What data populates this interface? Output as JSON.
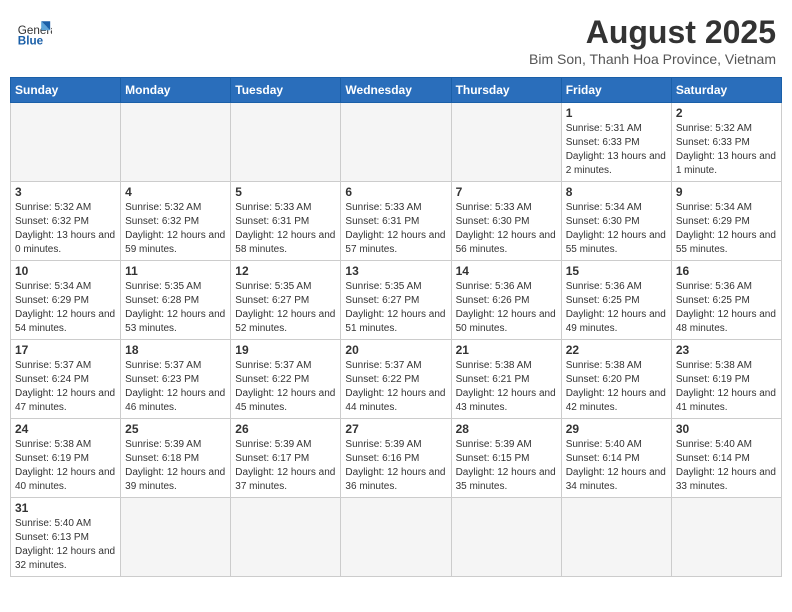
{
  "header": {
    "logo_general": "General",
    "logo_blue": "Blue",
    "month_year": "August 2025",
    "location": "Bim Son, Thanh Hoa Province, Vietnam"
  },
  "weekdays": [
    "Sunday",
    "Monday",
    "Tuesday",
    "Wednesday",
    "Thursday",
    "Friday",
    "Saturday"
  ],
  "weeks": [
    [
      {
        "day": "",
        "info": ""
      },
      {
        "day": "",
        "info": ""
      },
      {
        "day": "",
        "info": ""
      },
      {
        "day": "",
        "info": ""
      },
      {
        "day": "",
        "info": ""
      },
      {
        "day": "1",
        "info": "Sunrise: 5:31 AM\nSunset: 6:33 PM\nDaylight: 13 hours\nand 2 minutes."
      },
      {
        "day": "2",
        "info": "Sunrise: 5:32 AM\nSunset: 6:33 PM\nDaylight: 13 hours\nand 1 minute."
      }
    ],
    [
      {
        "day": "3",
        "info": "Sunrise: 5:32 AM\nSunset: 6:32 PM\nDaylight: 13 hours\nand 0 minutes."
      },
      {
        "day": "4",
        "info": "Sunrise: 5:32 AM\nSunset: 6:32 PM\nDaylight: 12 hours\nand 59 minutes."
      },
      {
        "day": "5",
        "info": "Sunrise: 5:33 AM\nSunset: 6:31 PM\nDaylight: 12 hours\nand 58 minutes."
      },
      {
        "day": "6",
        "info": "Sunrise: 5:33 AM\nSunset: 6:31 PM\nDaylight: 12 hours\nand 57 minutes."
      },
      {
        "day": "7",
        "info": "Sunrise: 5:33 AM\nSunset: 6:30 PM\nDaylight: 12 hours\nand 56 minutes."
      },
      {
        "day": "8",
        "info": "Sunrise: 5:34 AM\nSunset: 6:30 PM\nDaylight: 12 hours\nand 55 minutes."
      },
      {
        "day": "9",
        "info": "Sunrise: 5:34 AM\nSunset: 6:29 PM\nDaylight: 12 hours\nand 55 minutes."
      }
    ],
    [
      {
        "day": "10",
        "info": "Sunrise: 5:34 AM\nSunset: 6:29 PM\nDaylight: 12 hours\nand 54 minutes."
      },
      {
        "day": "11",
        "info": "Sunrise: 5:35 AM\nSunset: 6:28 PM\nDaylight: 12 hours\nand 53 minutes."
      },
      {
        "day": "12",
        "info": "Sunrise: 5:35 AM\nSunset: 6:27 PM\nDaylight: 12 hours\nand 52 minutes."
      },
      {
        "day": "13",
        "info": "Sunrise: 5:35 AM\nSunset: 6:27 PM\nDaylight: 12 hours\nand 51 minutes."
      },
      {
        "day": "14",
        "info": "Sunrise: 5:36 AM\nSunset: 6:26 PM\nDaylight: 12 hours\nand 50 minutes."
      },
      {
        "day": "15",
        "info": "Sunrise: 5:36 AM\nSunset: 6:25 PM\nDaylight: 12 hours\nand 49 minutes."
      },
      {
        "day": "16",
        "info": "Sunrise: 5:36 AM\nSunset: 6:25 PM\nDaylight: 12 hours\nand 48 minutes."
      }
    ],
    [
      {
        "day": "17",
        "info": "Sunrise: 5:37 AM\nSunset: 6:24 PM\nDaylight: 12 hours\nand 47 minutes."
      },
      {
        "day": "18",
        "info": "Sunrise: 5:37 AM\nSunset: 6:23 PM\nDaylight: 12 hours\nand 46 minutes."
      },
      {
        "day": "19",
        "info": "Sunrise: 5:37 AM\nSunset: 6:22 PM\nDaylight: 12 hours\nand 45 minutes."
      },
      {
        "day": "20",
        "info": "Sunrise: 5:37 AM\nSunset: 6:22 PM\nDaylight: 12 hours\nand 44 minutes."
      },
      {
        "day": "21",
        "info": "Sunrise: 5:38 AM\nSunset: 6:21 PM\nDaylight: 12 hours\nand 43 minutes."
      },
      {
        "day": "22",
        "info": "Sunrise: 5:38 AM\nSunset: 6:20 PM\nDaylight: 12 hours\nand 42 minutes."
      },
      {
        "day": "23",
        "info": "Sunrise: 5:38 AM\nSunset: 6:19 PM\nDaylight: 12 hours\nand 41 minutes."
      }
    ],
    [
      {
        "day": "24",
        "info": "Sunrise: 5:38 AM\nSunset: 6:19 PM\nDaylight: 12 hours\nand 40 minutes."
      },
      {
        "day": "25",
        "info": "Sunrise: 5:39 AM\nSunset: 6:18 PM\nDaylight: 12 hours\nand 39 minutes."
      },
      {
        "day": "26",
        "info": "Sunrise: 5:39 AM\nSunset: 6:17 PM\nDaylight: 12 hours\nand 37 minutes."
      },
      {
        "day": "27",
        "info": "Sunrise: 5:39 AM\nSunset: 6:16 PM\nDaylight: 12 hours\nand 36 minutes."
      },
      {
        "day": "28",
        "info": "Sunrise: 5:39 AM\nSunset: 6:15 PM\nDaylight: 12 hours\nand 35 minutes."
      },
      {
        "day": "29",
        "info": "Sunrise: 5:40 AM\nSunset: 6:14 PM\nDaylight: 12 hours\nand 34 minutes."
      },
      {
        "day": "30",
        "info": "Sunrise: 5:40 AM\nSunset: 6:14 PM\nDaylight: 12 hours\nand 33 minutes."
      }
    ],
    [
      {
        "day": "31",
        "info": "Sunrise: 5:40 AM\nSunset: 6:13 PM\nDaylight: 12 hours\nand 32 minutes."
      },
      {
        "day": "",
        "info": ""
      },
      {
        "day": "",
        "info": ""
      },
      {
        "day": "",
        "info": ""
      },
      {
        "day": "",
        "info": ""
      },
      {
        "day": "",
        "info": ""
      },
      {
        "day": "",
        "info": ""
      }
    ]
  ]
}
